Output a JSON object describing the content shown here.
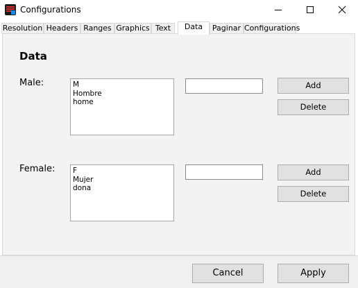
{
  "window": {
    "title": "Configurations"
  },
  "tabs": [
    "Resolution",
    "Headers",
    "Ranges",
    "Graphics",
    "Text",
    "Data",
    "Paginar",
    "Configurations"
  ],
  "active_tab": "Data",
  "section_title": "Data",
  "groups": [
    {
      "label": "Male:",
      "items": [
        "M",
        "Hombre",
        "home"
      ],
      "input_value": "",
      "add_label": "Add",
      "delete_label": "Delete"
    },
    {
      "label": "Female:",
      "items": [
        "F",
        "Mujer",
        "dona"
      ],
      "input_value": "",
      "add_label": "Add",
      "delete_label": "Delete"
    }
  ],
  "footer": {
    "cancel_label": "Cancel",
    "apply_label": "Apply"
  },
  "icons": [
    "app-icon",
    "minimize-icon",
    "maximize-icon",
    "close-icon"
  ]
}
